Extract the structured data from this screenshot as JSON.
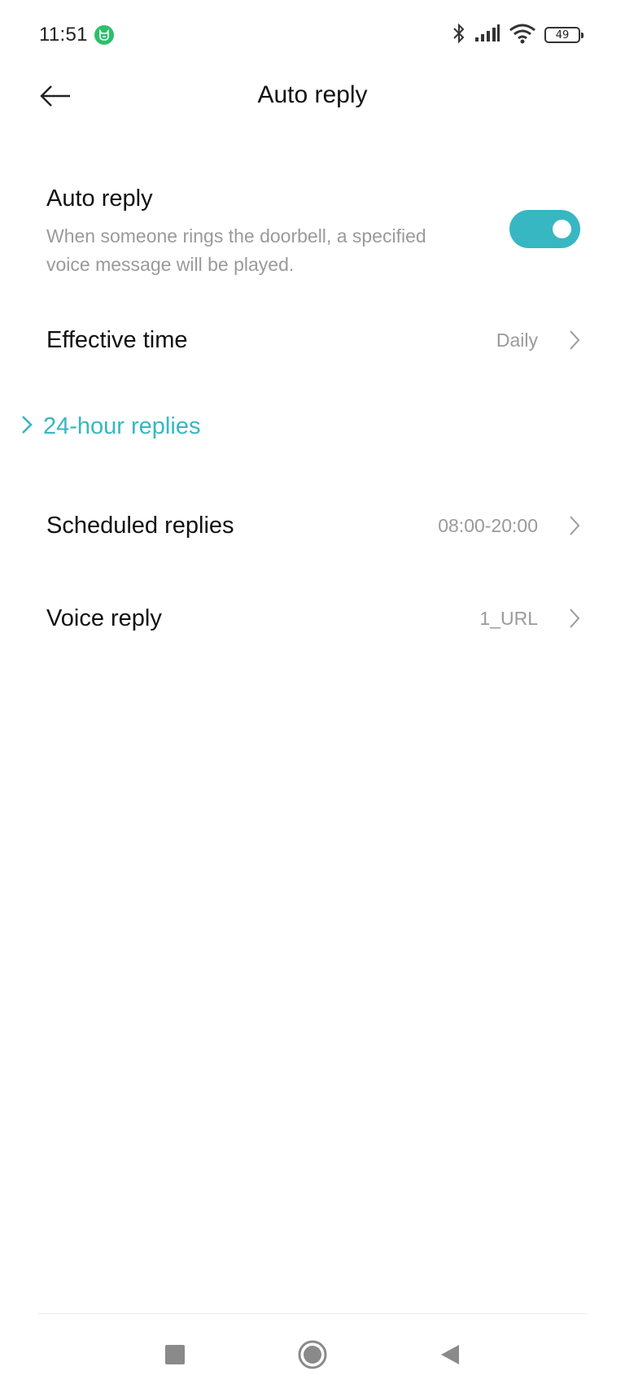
{
  "status_bar": {
    "time": "11:51",
    "battery_level": "49",
    "app_badge_color": "#2dbf6b",
    "icons": [
      "bluetooth-icon",
      "signal-icon",
      "wifi-icon",
      "battery-icon"
    ]
  },
  "header": {
    "title": "Auto reply",
    "back_icon": "back-arrow-icon"
  },
  "auto_reply": {
    "title": "Auto reply",
    "description": "When someone rings the doorbell, a specified voice message will be played.",
    "enabled": true,
    "toggle_color": "#37b7c2"
  },
  "effective_time": {
    "label": "Effective time",
    "value": "Daily"
  },
  "section_24h": {
    "label": "24-hour replies",
    "color": "#37b7c2"
  },
  "scheduled_replies": {
    "label": "Scheduled replies",
    "value": "08:00-20:00"
  },
  "voice_reply": {
    "label": "Voice reply",
    "value": "1_URL"
  },
  "nav": {
    "icons": [
      "recents-square-icon",
      "home-circle-icon",
      "back-triangle-icon"
    ]
  }
}
